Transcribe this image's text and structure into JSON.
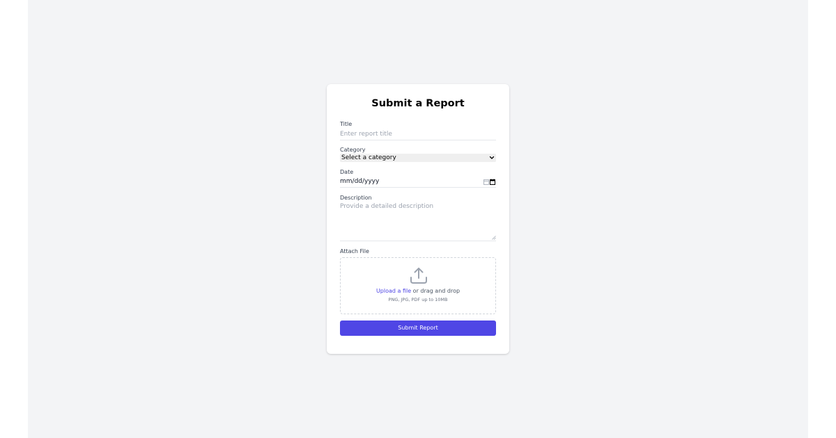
{
  "form": {
    "heading": "Submit a Report",
    "title_field": {
      "label": "Title",
      "placeholder": "Enter report title"
    },
    "category_field": {
      "label": "Category",
      "selected": "Select a category"
    },
    "date_field": {
      "label": "Date",
      "value": "mm/dd/yyyy"
    },
    "description_field": {
      "label": "Description",
      "placeholder": "Provide a detailed description"
    },
    "attach_field": {
      "label": "Attach File",
      "upload_link": "Upload a file",
      "drag_text": " or drag and drop",
      "hint": "PNG, JPG, PDF up to 10MB"
    },
    "submit_label": "Submit Report"
  },
  "icons": {
    "upload": "upload-icon",
    "calendar": "calendar-icon",
    "chevron": "chevron-down-icon"
  },
  "colors": {
    "accent": "#4f46e5",
    "background": "#f3f4f6",
    "card": "#ffffff"
  }
}
